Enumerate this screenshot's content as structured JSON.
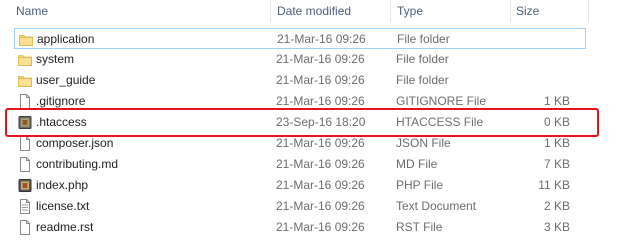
{
  "columns": {
    "name": "Name",
    "date": "Date modified",
    "type": "Type",
    "size": "Size"
  },
  "files": [
    {
      "name": "application",
      "date": "21-Mar-16 09:26",
      "type": "File folder",
      "size": "",
      "icon": "folder-icon"
    },
    {
      "name": "system",
      "date": "21-Mar-16 09:26",
      "type": "File folder",
      "size": "",
      "icon": "folder-icon"
    },
    {
      "name": "user_guide",
      "date": "21-Mar-16 09:26",
      "type": "File folder",
      "size": "",
      "icon": "folder-icon"
    },
    {
      "name": ".gitignore",
      "date": "21-Mar-16 09:26",
      "type": "GITIGNORE File",
      "size": "1 KB",
      "icon": "document-icon"
    },
    {
      "name": ".htaccess",
      "date": "23-Sep-16 18:20",
      "type": "HTACCESS File",
      "size": "0 KB",
      "icon": "htaccess-icon"
    },
    {
      "name": "composer.json",
      "date": "21-Mar-16 09:26",
      "type": "JSON File",
      "size": "1 KB",
      "icon": "document-icon"
    },
    {
      "name": "contributing.md",
      "date": "21-Mar-16 09:26",
      "type": "MD File",
      "size": "7 KB",
      "icon": "document-icon"
    },
    {
      "name": "index.php",
      "date": "21-Mar-16 09:26",
      "type": "PHP File",
      "size": "11 KB",
      "icon": "php-icon"
    },
    {
      "name": "license.txt",
      "date": "21-Mar-16 09:26",
      "type": "Text Document",
      "size": "2 KB",
      "icon": "text-document-icon"
    },
    {
      "name": "readme.rst",
      "date": "21-Mar-16 09:26",
      "type": "RST File",
      "size": "3 KB",
      "icon": "document-icon"
    }
  ],
  "colors": {
    "highlight": "#e8121c",
    "folder": "#f8d775",
    "header_text": "#4c607a",
    "focus_border": "#99d1ff"
  }
}
